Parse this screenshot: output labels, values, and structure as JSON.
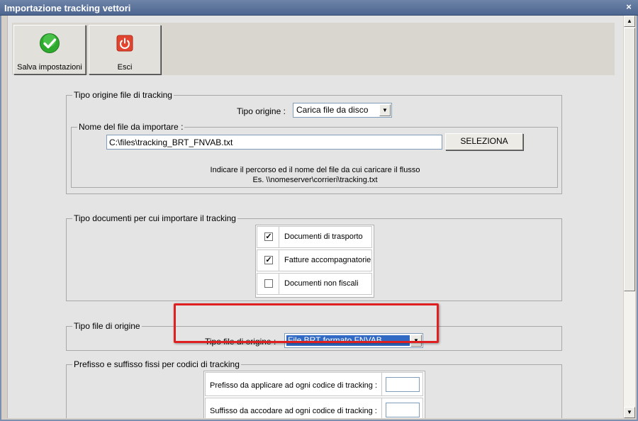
{
  "window": {
    "title": "Importazione tracking vettori",
    "close_glyph": "×"
  },
  "toolbar": {
    "save_label": "Salva impostazioni",
    "save_icon": "check-icon",
    "exit_label": "Esci",
    "exit_icon": "power-icon"
  },
  "origin_group": {
    "legend": "Tipo origine file di tracking",
    "type_label": "Tipo origine :",
    "type_value": "Carica file da disco",
    "file_group": {
      "legend": "Nome del file da importare :",
      "file_value": "C:\\files\\tracking_BRT_FNVAB.txt",
      "select_button": "SELEZIONA",
      "hint_line1": "Indicare il percorso ed il nome del file da cui caricare il flusso",
      "hint_line2": "Es. \\\\nomeserver\\corrieri\\tracking.txt"
    }
  },
  "documents_group": {
    "legend": "Tipo documenti per cui importare il tracking",
    "items": [
      {
        "label": "Documenti di trasporto",
        "checked": "✓"
      },
      {
        "label": "Fatture accompagnatorie",
        "checked": "✓"
      },
      {
        "label": "Documenti non fiscali",
        "checked": ""
      }
    ]
  },
  "filetype_group": {
    "legend": "Tipo file di origine",
    "type_label": "Tipo file di origine :",
    "type_value": "File BRT formato FNVAB"
  },
  "prefix_group": {
    "legend": "Prefisso e suffisso fissi per codici di tracking",
    "prefix_label": "Prefisso da applicare ad ogni codice di tracking :",
    "prefix_value": "",
    "suffix_label": "Suffisso da accodare ad ogni codice di tracking :",
    "suffix_value": ""
  },
  "colors": {
    "highlight": "#E02020",
    "selection": "#316AC5",
    "title_bar": "#4D6690"
  }
}
